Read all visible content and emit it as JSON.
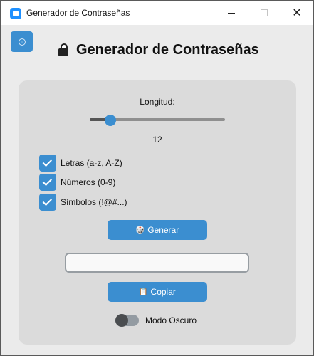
{
  "window": {
    "title": "Generador de Contraseñas",
    "controls": {
      "minimize": "—",
      "maximize": "☐",
      "close": "✕"
    }
  },
  "header": {
    "icon": "lock-icon",
    "title": "Generador de Contraseñas"
  },
  "theme_button": {
    "icon": "theme-icon"
  },
  "length": {
    "label": "Longitud:",
    "value": "12",
    "slider_fraction": 0.15
  },
  "options": [
    {
      "label": "Letras (a-z, A-Z)",
      "checked": true
    },
    {
      "label": "Números (0-9)",
      "checked": true
    },
    {
      "label": "Símbolos (!@#...)",
      "checked": true
    }
  ],
  "generate_button": {
    "icon": "🎲",
    "label": "Generar"
  },
  "password_field": {
    "value": ""
  },
  "copy_button": {
    "icon": "📋",
    "label": "Copiar"
  },
  "dark_mode": {
    "label": "Modo Oscuro",
    "on": false
  },
  "colors": {
    "accent": "#3b8ed0",
    "card": "#dbdbdb",
    "background": "#ebebeb"
  }
}
